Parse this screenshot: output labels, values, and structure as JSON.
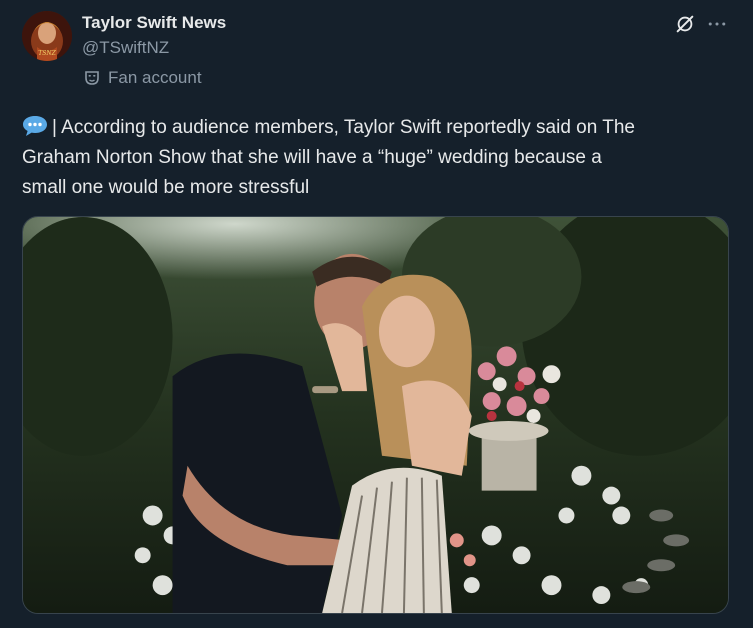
{
  "author": {
    "display_name": "Taylor Swift News",
    "handle": "@TSwiftNZ",
    "account_label": "Fan account",
    "avatar_icon": "profile-avatar"
  },
  "header_actions": {
    "grok_icon": "grok-icon",
    "more_icon": "more-icon"
  },
  "tweet": {
    "emoji_icon": "speech-balloon-icon",
    "text_line_1": "| According to audience members, Taylor Swift reportedly said on The",
    "text_line_2": "Graham Norton Show that she will have a “huge” wedding because a",
    "text_line_3": "small one would be more stressful"
  },
  "media": {
    "type": "photo"
  },
  "colors": {
    "background": "#15202b",
    "primary_text": "#e7e9ea",
    "secondary_text": "#8b98a5",
    "border": "#38444d",
    "emoji_blue": "#5aa9e6"
  }
}
